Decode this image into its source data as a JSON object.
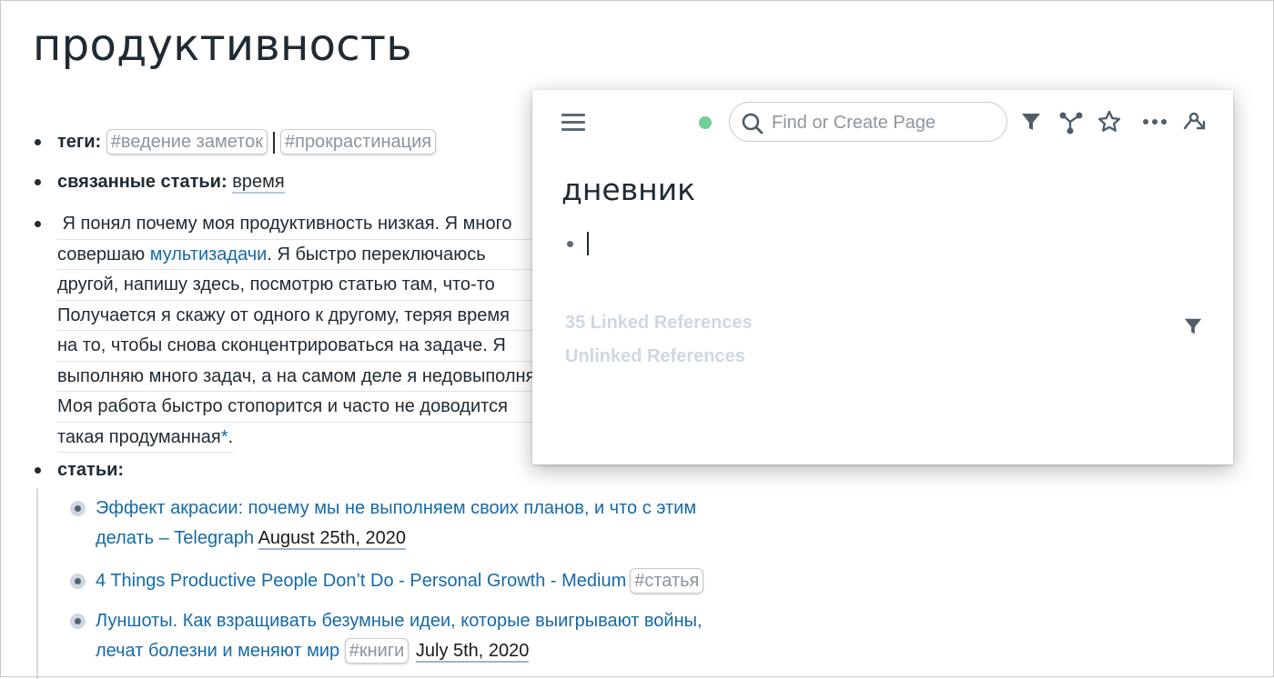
{
  "page": {
    "title": "продуктивность",
    "tags_label": "теги:",
    "tags": [
      "#ведение заметок",
      "#прокрастинация"
    ],
    "related_label": "связанные статьи:",
    "related_link": "время",
    "paragraph_lines": [
      " Я понял почему моя продуктивность низкая. Я много",
      "совершаю ",
      "другой, напишу здесь, посмотрю статью там, что-то",
      "Получается я скажу от одного к другому, теряя время",
      "на то, чтобы снова сконцентрироваться на задаче. Я",
      "выполняю много задач, а на самом деле я недовыполняю",
      "Моя работа быстро стопорится и часто не доводится",
      "такая продуманная"
    ],
    "paragraph_link": "мультизадачи",
    "paragraph_line2_rest": ". Я быстро переключаюсь",
    "paragraph_asterisk": "*",
    "paragraph_end": ".",
    "articles_label": "статьи:",
    "articles": [
      {
        "line1": "Эффект акрасии: почему мы не выполняем своих планов, и что с этим",
        "line2": "делать – Telegraph",
        "date": "August 25th, 2020"
      },
      {
        "line1": "4 Things Productive People Don’t Do - Personal Growth - Medium",
        "tag": "#статья"
      },
      {
        "line1": "Луншоты. Как взращивать безумные идеи, которые выигрывают войны,",
        "line2": "лечат болезни и меняют мир",
        "tag": "#книги",
        "date": "July 5th, 2020"
      }
    ]
  },
  "popup": {
    "search_placeholder": "Find or Create Page",
    "title": "дневник",
    "linked_refs": "35 Linked References",
    "unlinked_refs": "Unlinked References",
    "icons": [
      "menu-icon",
      "sync-status-icon",
      "search-icon",
      "filter-icon",
      "graph-icon",
      "star-icon",
      "more-icon",
      "share-icon"
    ],
    "sync_color": "#6fcf97"
  }
}
